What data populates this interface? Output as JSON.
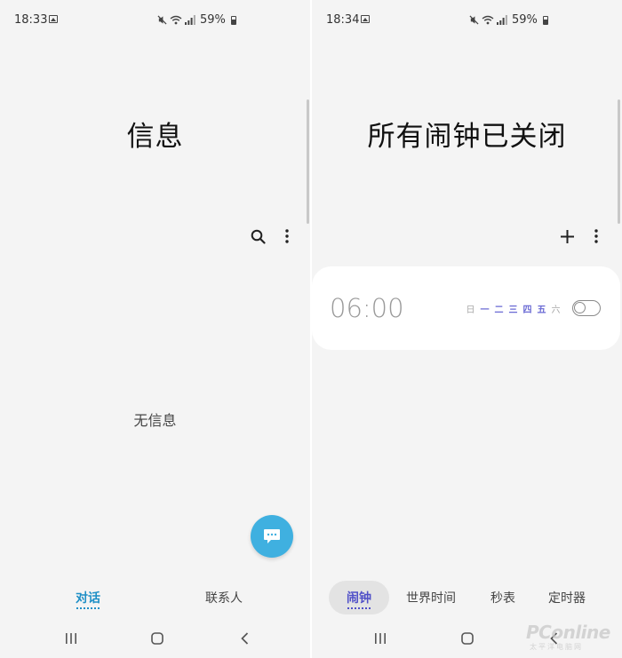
{
  "left": {
    "status": {
      "time": "18:33",
      "battery": "59%"
    },
    "title": "信息",
    "empty_text": "无信息",
    "icons": {
      "search": "search-icon",
      "more": "more-vertical-icon",
      "fab": "chat-bubble-icon"
    },
    "tabs": [
      {
        "label": "对话",
        "active": true
      },
      {
        "label": "联系人",
        "active": false
      }
    ]
  },
  "right": {
    "status": {
      "time": "18:34",
      "battery": "59%"
    },
    "title": "所有闹钟已关闭",
    "alarm": {
      "time": "06:00",
      "days": [
        {
          "label": "日",
          "on": false
        },
        {
          "label": "一",
          "on": true
        },
        {
          "label": "二",
          "on": true
        },
        {
          "label": "三",
          "on": true
        },
        {
          "label": "四",
          "on": true
        },
        {
          "label": "五",
          "on": true
        },
        {
          "label": "六",
          "on": false
        }
      ],
      "enabled": false
    },
    "tabs": [
      {
        "label": "闹钟",
        "active": true
      },
      {
        "label": "世界时间",
        "active": false
      },
      {
        "label": "秒表",
        "active": false
      },
      {
        "label": "定时器",
        "active": false
      }
    ]
  },
  "watermark": {
    "brand": "PConline",
    "sub": "太平洋电脑网"
  },
  "colors": {
    "accent_messages": "#1e8fc6",
    "fab": "#3fb0e0",
    "accent_clock": "#5050c8",
    "background": "#f4f4f4"
  }
}
